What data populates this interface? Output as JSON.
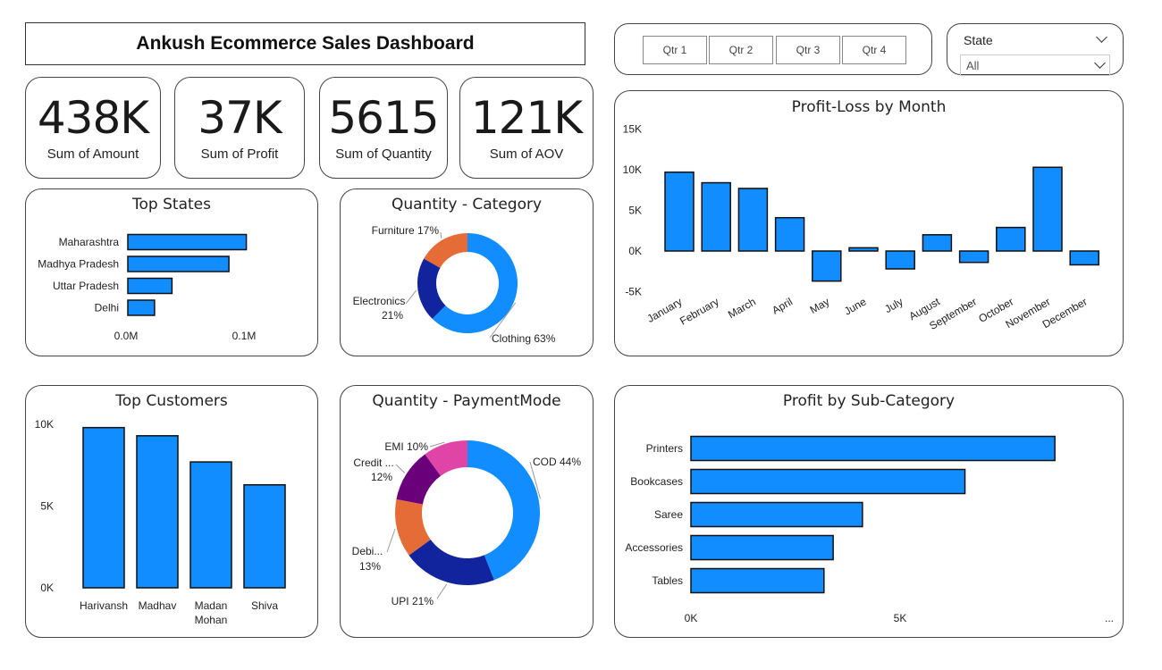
{
  "header": {
    "title": "Ankush Ecommerce Sales Dashboard"
  },
  "kpis": [
    {
      "value": "438K",
      "label": "Sum of Amount"
    },
    {
      "value": "37K",
      "label": "Sum of Profit"
    },
    {
      "value": "5615",
      "label": "Sum of Quantity"
    },
    {
      "value": "121K",
      "label": "Sum of AOV"
    }
  ],
  "quarters": [
    "Qtr 1",
    "Qtr 2",
    "Qtr 3",
    "Qtr 4"
  ],
  "state_slicer": {
    "label": "State",
    "value": "All"
  },
  "colors": {
    "bar": "#118DFF",
    "donut_blue": "#118DFF",
    "donut_navy": "#12239E",
    "donut_orange": "#E66C37",
    "donut_purple": "#6B007B",
    "donut_pink": "#E044A7"
  },
  "chart_data": [
    {
      "id": "top_states",
      "type": "bar",
      "orientation": "horizontal",
      "title": "Top States",
      "categories": [
        "Maharashtra",
        "Madhya Pradesh",
        "Uttar Pradesh",
        "Delhi"
      ],
      "values": [
        0.102,
        0.087,
        0.038,
        0.023
      ],
      "unit": "M",
      "xticks": [
        "0.0M",
        "0.1M"
      ],
      "xlim": [
        0,
        0.115
      ]
    },
    {
      "id": "quantity_category",
      "type": "pie",
      "donut": true,
      "title": "Quantity - Category",
      "slices": [
        {
          "label": "Clothing",
          "pct": 63,
          "text": "Clothing 63%",
          "color": "#118DFF"
        },
        {
          "label": "Electronics",
          "pct": 21,
          "text1": "Electronics",
          "text2": "21%",
          "color": "#12239E"
        },
        {
          "label": "Furniture",
          "pct": 17,
          "text": "Furniture 17%",
          "color": "#E66C37"
        }
      ]
    },
    {
      "id": "profit_loss_month",
      "type": "bar",
      "title": "Profit-Loss by Month",
      "categories": [
        "January",
        "February",
        "March",
        "April",
        "May",
        "June",
        "July",
        "August",
        "September",
        "October",
        "November",
        "December"
      ],
      "values": [
        9700,
        8400,
        7700,
        4100,
        -3700,
        400,
        -2200,
        2000,
        -1400,
        2900,
        10300,
        -1700
      ],
      "yticks": [
        "15K",
        "10K",
        "5K",
        "0K",
        "-5K"
      ],
      "ytick_values": [
        15000,
        10000,
        5000,
        0,
        -5000
      ],
      "ylim": [
        -5000,
        15000
      ]
    },
    {
      "id": "top_customers",
      "type": "bar",
      "title": "Top Customers",
      "categories": [
        [
          "Harivansh"
        ],
        [
          "Madhav"
        ],
        [
          "Madan",
          "Mohan"
        ],
        [
          "Shiva"
        ]
      ],
      "values": [
        9800,
        9300,
        7700,
        6300
      ],
      "yticks": [
        "10K",
        "5K",
        "0K"
      ],
      "ytick_values": [
        10000,
        5000,
        0
      ],
      "ylim": [
        0,
        10000
      ]
    },
    {
      "id": "quantity_paymentmode",
      "type": "pie",
      "donut": true,
      "title": "Quantity - PaymentMode",
      "slices": [
        {
          "label": "COD",
          "pct": 44,
          "text": "COD 44%",
          "color": "#118DFF"
        },
        {
          "label": "UPI",
          "pct": 21,
          "text": "UPI 21%",
          "color": "#12239E"
        },
        {
          "label": "Debi...",
          "pct": 13,
          "text1": "Debi...",
          "text2": "13%",
          "color": "#E66C37"
        },
        {
          "label": "Credit ...",
          "pct": 12,
          "text1": "Credit ...",
          "text2": "12%",
          "color": "#6B007B"
        },
        {
          "label": "EMI",
          "pct": 10,
          "text": "EMI 10%",
          "color": "#E044A7"
        }
      ]
    },
    {
      "id": "profit_subcategory",
      "type": "bar",
      "orientation": "horizontal",
      "title": "Profit by Sub-Category",
      "categories": [
        "Printers",
        "Bookcases",
        "Saree",
        "Accessories",
        "Tables"
      ],
      "values": [
        8700,
        6550,
        4100,
        3400,
        3180
      ],
      "xticks": [
        "0K",
        "5K"
      ],
      "xtick_values": [
        0,
        5000
      ],
      "xlim": [
        0,
        10000
      ],
      "overflow_marker": "..."
    }
  ]
}
